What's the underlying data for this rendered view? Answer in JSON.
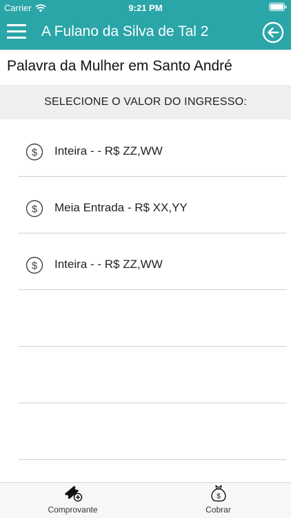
{
  "status_bar": {
    "carrier": "Carrier",
    "time": "9:21 PM",
    "wifi_icon": "wifi-icon",
    "battery_icon": "battery-icon"
  },
  "nav": {
    "title": "A Fulano da Silva de Tal 2",
    "menu_icon": "hamburger-menu-icon",
    "back_icon": "arrow-left-circle-icon",
    "color": "#2aa5a8"
  },
  "event_title": "Palavra da Mulher em Santo André",
  "section_header": "SELECIONE O VALOR DO INGRESSO:",
  "tickets": [
    {
      "label": "Inteira - - R$ ZZ,WW",
      "icon": "dollar-coin-icon"
    },
    {
      "label": "Meia Entrada - R$ XX,YY",
      "icon": "dollar-coin-icon"
    },
    {
      "label": "Inteira - - R$ ZZ,WW",
      "icon": "dollar-coin-icon"
    }
  ],
  "tab_bar": {
    "tabs": [
      {
        "label": "Comprovante",
        "icon": "ticket-add-icon"
      },
      {
        "label": "Cobrar",
        "icon": "money-bag-icon"
      }
    ]
  }
}
